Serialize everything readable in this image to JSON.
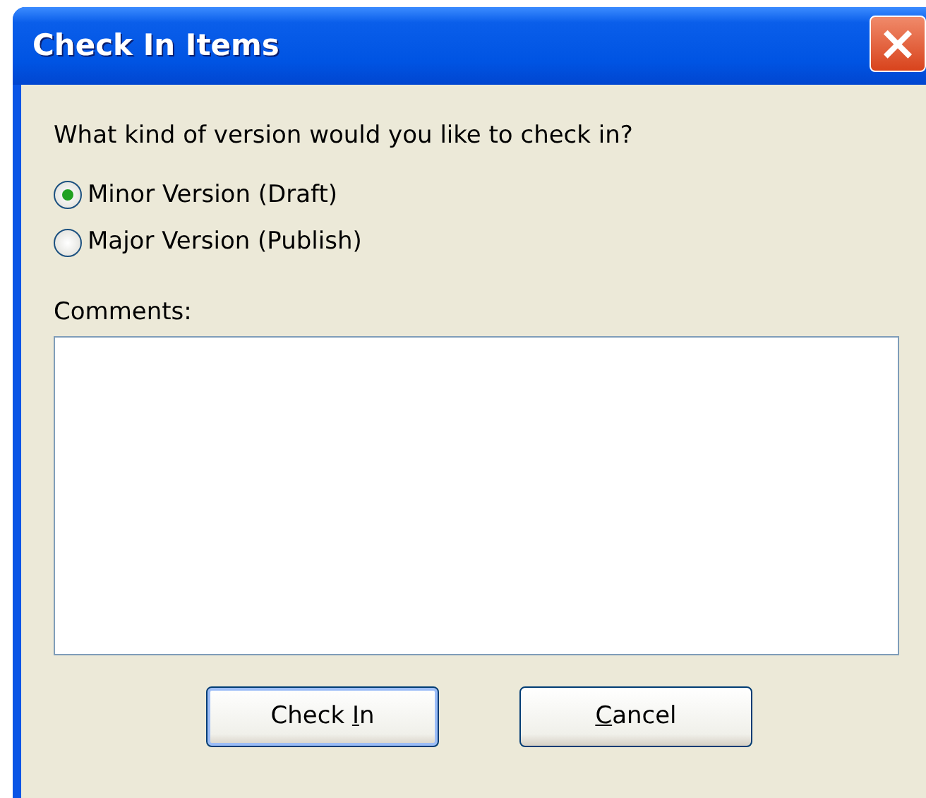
{
  "window": {
    "title": "Check In Items",
    "close": "×"
  },
  "question": "What kind of version would you like to check in?",
  "options": [
    {
      "label": "Minor Version (Draft)",
      "selected": true
    },
    {
      "label": "Major Version (Publish)",
      "selected": false
    }
  ],
  "comments": {
    "label": "Comments:"
  },
  "buttons": [
    {
      "before": "Check ",
      "key": "I",
      "after": "n",
      "default": true
    },
    {
      "key": "C",
      "after": "ancel",
      "default": false
    }
  ]
}
